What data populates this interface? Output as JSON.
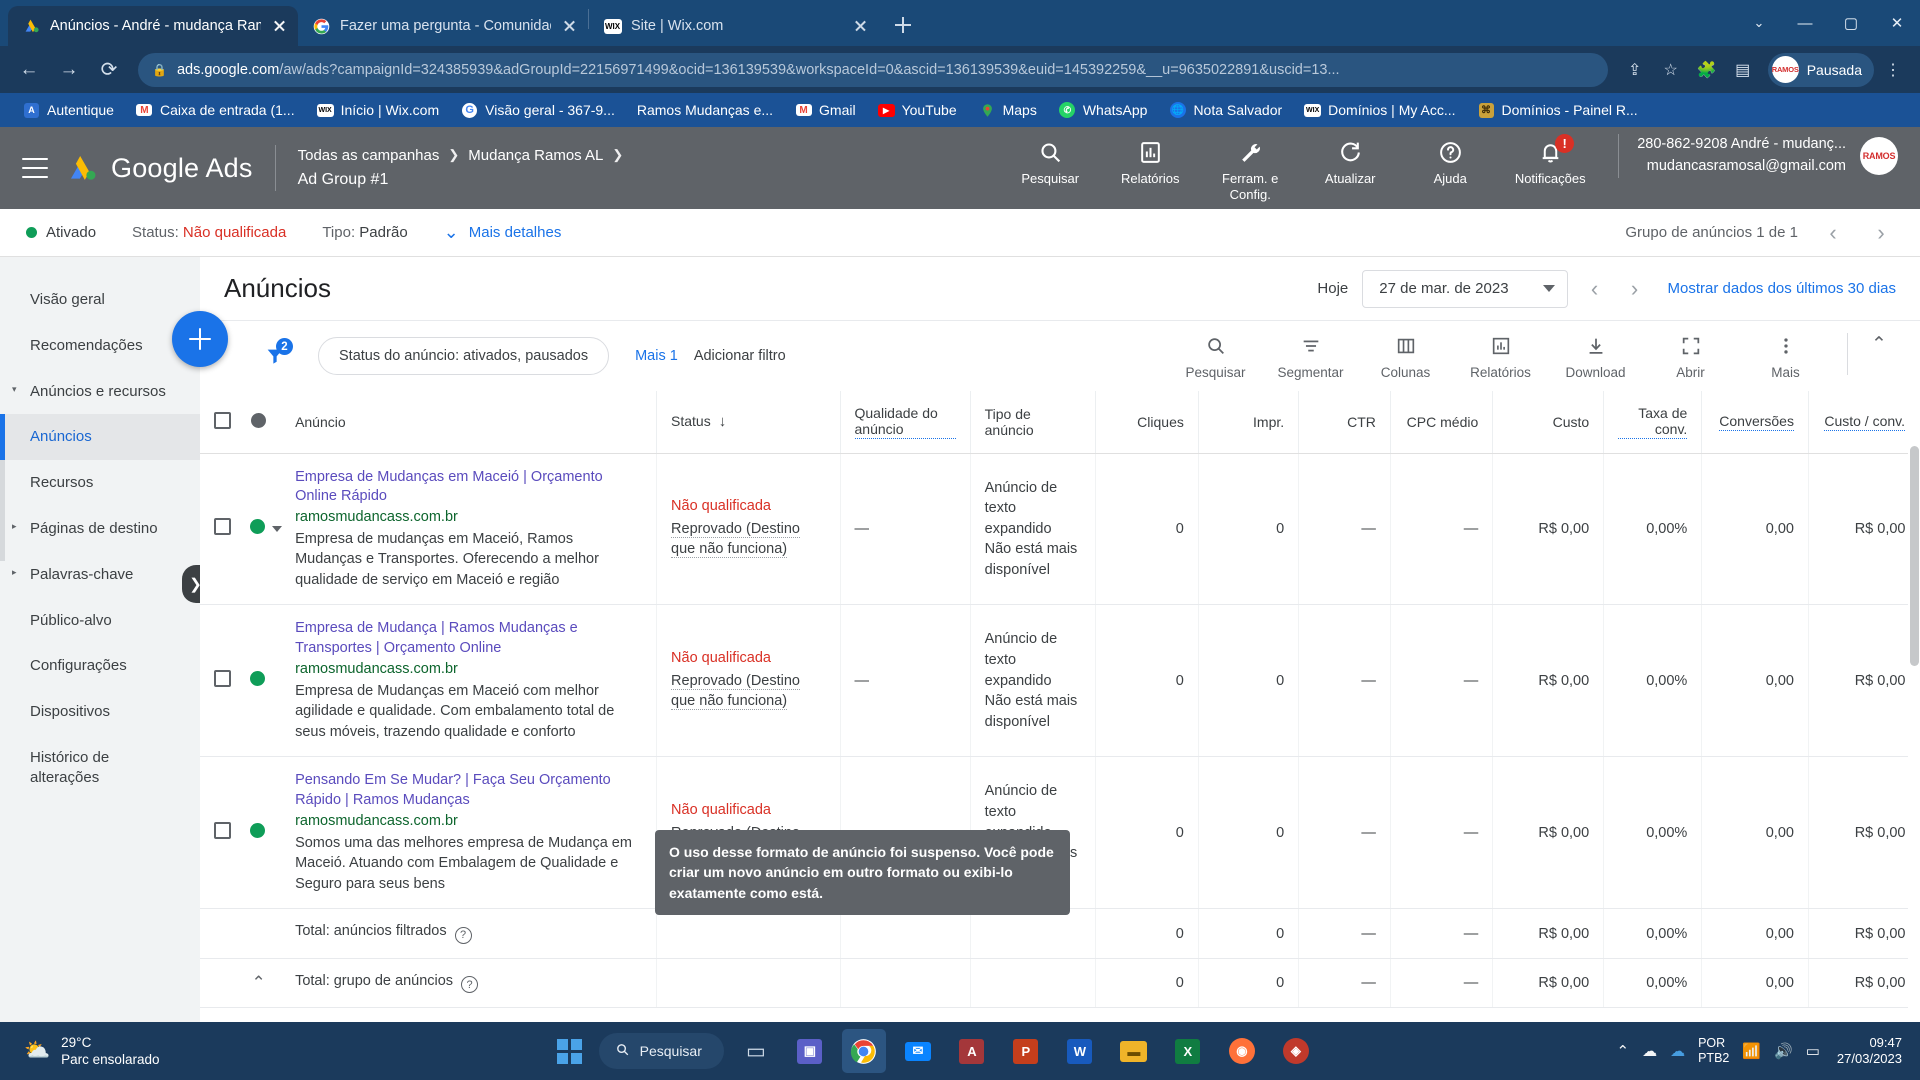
{
  "browser": {
    "tabs": [
      {
        "title": "Anúncios - André - mudança Ram",
        "favicon": "google-ads-icon",
        "active": true
      },
      {
        "title": "Fazer uma pergunta - Comunidad",
        "favicon": "google-icon",
        "active": false
      },
      {
        "title": "Site | Wix.com",
        "favicon": "wix-icon",
        "active": false
      }
    ],
    "new_tab_label": "+",
    "window_controls": [
      "chevron-down",
      "minimize",
      "maximize",
      "close"
    ],
    "url": {
      "host": "ads.google.com",
      "path": "/aw/ads?campaignId=324385939&adGroupId=22156971499&ocid=136139539&workspaceId=0&ascid=136139539&euid=145392259&__u=9635022891&uscid=13...",
      "lock": "lock-icon"
    },
    "profile_chip": {
      "label": "Pausada",
      "avatar_text": "RAMOS"
    },
    "bookmarks": [
      {
        "label": "Autentique",
        "icon": "autentique-icon"
      },
      {
        "label": "Caixa de entrada (1...",
        "icon": "gmail-icon"
      },
      {
        "label": "Início | Wix.com",
        "icon": "wix-icon"
      },
      {
        "label": "Visão geral - 367-9...",
        "icon": "google-icon"
      },
      {
        "label": "Ramos Mudanças e...",
        "icon": "none"
      },
      {
        "label": "Gmail",
        "icon": "gmail-icon"
      },
      {
        "label": "YouTube",
        "icon": "youtube-icon"
      },
      {
        "label": "Maps",
        "icon": "maps-icon"
      },
      {
        "label": "WhatsApp",
        "icon": "whatsapp-icon"
      },
      {
        "label": "Nota Salvador",
        "icon": "globe-icon"
      },
      {
        "label": "Domínios | My Acc...",
        "icon": "wix-icon"
      },
      {
        "label": "Domínios - Painel R...",
        "icon": "domains-icon"
      }
    ]
  },
  "ads_header": {
    "logo_text": "Google Ads",
    "breadcrumb": {
      "level1": "Todas as campanhas",
      "level2": "Mudança Ramos AL",
      "level3": "Ad Group #1"
    },
    "actions": [
      {
        "label": "Pesquisar",
        "icon": "search-icon"
      },
      {
        "label": "Relatórios",
        "icon": "report-icon"
      },
      {
        "label": "Ferram. e Config.",
        "icon": "wrench-icon"
      },
      {
        "label": "Atualizar",
        "icon": "refresh-icon"
      },
      {
        "label": "Ajuda",
        "icon": "help-icon"
      },
      {
        "label": "Notificações",
        "icon": "bell-icon",
        "badge": "!"
      }
    ],
    "account": {
      "id_name": "280-862-9208 André - mudanç...",
      "email": "mudancasramosal@gmail.com",
      "avatar_text": "RAMOS"
    }
  },
  "status_bar": {
    "state": "Ativado",
    "status_label": "Status:",
    "status_value": "Não qualificada",
    "type_label": "Tipo:",
    "type_value": "Padrão",
    "more_details": "Mais detalhes",
    "pager": "Grupo de anúncios 1 de 1"
  },
  "sidebar": {
    "items": [
      {
        "label": "Visão geral",
        "state": "normal"
      },
      {
        "label": "Recomendações",
        "state": "normal"
      },
      {
        "label": "Anúncios e recursos",
        "state": "expandable-open"
      },
      {
        "label": "Anúncios",
        "state": "active-sub"
      },
      {
        "label": "Recursos",
        "state": "sub"
      },
      {
        "label": "Páginas de destino",
        "state": "expandable"
      },
      {
        "label": "Palavras-chave",
        "state": "expandable"
      },
      {
        "label": "Público-alvo",
        "state": "normal"
      },
      {
        "label": "Configurações",
        "state": "normal"
      },
      {
        "label": "Dispositivos",
        "state": "normal"
      },
      {
        "label": "Histórico de alterações",
        "state": "normal"
      }
    ],
    "toggle_icon": "chevron-right-icon"
  },
  "main": {
    "page_title": "Anúncios",
    "date": {
      "today_label": "Hoje",
      "value": "27 de mar. de 2023",
      "show_last_30": "Mostrar dados dos últimos 30 dias"
    },
    "toolbar": {
      "add_button": "add-button",
      "filter_count": "2",
      "filter_chip": "Status do anúncio: ativados, pausados",
      "more_filters": "Mais 1",
      "add_filter": "Adicionar filtro",
      "actions": [
        {
          "label": "Pesquisar",
          "icon": "search-icon"
        },
        {
          "label": "Segmentar",
          "icon": "segment-icon"
        },
        {
          "label": "Colunas",
          "icon": "columns-icon"
        },
        {
          "label": "Relatórios",
          "icon": "chart-icon"
        },
        {
          "label": "Download",
          "icon": "download-icon"
        },
        {
          "label": "Abrir",
          "icon": "expand-icon"
        },
        {
          "label": "Mais",
          "icon": "more-vert-icon"
        }
      ],
      "collapse": "chevron-up-icon"
    }
  },
  "table": {
    "columns": [
      "Anúncio",
      "Status",
      "Qualidade do anúncio",
      "Tipo de anúncio",
      "Cliques",
      "Impr.",
      "CTR",
      "CPC médio",
      "Custo",
      "Taxa de conv.",
      "Conversões",
      "Custo / conv."
    ],
    "sorted_column": "Status",
    "sort_direction": "down-arrow",
    "rows": [
      {
        "dot": "green",
        "has_caret": true,
        "ad_title": "Empresa de Mudanças em Maceió | Orçamento Online Rápido",
        "ad_url": "ramosmudancass.com.br",
        "ad_desc": "Empresa de mudanças em Maceió, Ramos Mudanças e Transportes. Oferecendo a melhor qualidade de serviço em Maceió e região",
        "status_primary": "Não qualificada",
        "status_secondary": "Reprovado (Destino que não funciona)",
        "quality": "—",
        "ad_type": "Anúncio de texto expandido Não está mais disponível",
        "cliques": "0",
        "impr": "0",
        "ctr": "—",
        "cpc": "—",
        "custo": "R$ 0,00",
        "taxa_conv": "0,00%",
        "conversoes": "0,00",
        "custo_conv": "R$ 0,00"
      },
      {
        "dot": "green",
        "has_caret": false,
        "ad_title": "Empresa de Mudança | Ramos Mudanças e Transportes | Orçamento Online",
        "ad_url": "ramosmudancass.com.br",
        "ad_desc": "Empresa de Mudanças em Maceió com melhor agilidade e qualidade. Com embalamento total de seus móveis, trazendo qualidade e conforto",
        "status_primary": "Não qualificada",
        "status_secondary": "Reprovado (Destino que não funciona)",
        "quality": "—",
        "ad_type": "Anúncio de texto expandido Não está mais disponível",
        "cliques": "0",
        "impr": "0",
        "ctr": "—",
        "cpc": "—",
        "custo": "R$ 0,00",
        "taxa_conv": "0,00%",
        "conversoes": "0,00",
        "custo_conv": "R$ 0,00"
      },
      {
        "dot": "green",
        "has_caret": false,
        "ad_title": "Pensando Em Se Mudar? | Faça Seu Orçamento Rápido | Ramos Mudanças",
        "ad_url": "ramosmudancass.com.br",
        "ad_desc": "Somos uma das melhores empresa de Mudança em Maceió. Atuando com Embalagem de Qualidade e Seguro para seus bens",
        "status_primary": "Não qualificada",
        "status_secondary": "Reprovado (Destino que não funciona)",
        "quality": "—",
        "ad_type": "Anúncio de texto expandido Não está mais disponível",
        "cliques": "0",
        "impr": "0",
        "ctr": "—",
        "cpc": "—",
        "custo": "R$ 0,00",
        "taxa_conv": "0,00%",
        "conversoes": "0,00",
        "custo_conv": "R$ 0,00"
      }
    ],
    "totals": [
      {
        "label": "Total: anúncios filtrados",
        "has_help": true,
        "has_collapse": false,
        "cliques": "0",
        "impr": "0",
        "ctr": "—",
        "cpc": "—",
        "custo": "R$ 0,00",
        "taxa_conv": "0,00%",
        "conversoes": "0,00",
        "custo_conv": "R$ 0,00"
      },
      {
        "label": "Total: grupo de anúncios",
        "has_help": true,
        "has_collapse": true,
        "cliques": "0",
        "impr": "0",
        "ctr": "—",
        "cpc": "—",
        "custo": "R$ 0,00",
        "taxa_conv": "0,00%",
        "conversoes": "0,00",
        "custo_conv": "R$ 0,00"
      }
    ]
  },
  "tooltip": {
    "text": "O uso desse formato de anúncio foi suspenso. Você pode criar um novo anúncio em outro formato ou exibi-lo exatamente como está."
  },
  "taskbar": {
    "weather": {
      "temp": "29°C",
      "desc": "Parc ensolarado",
      "icon": "sun-cloud-icon"
    },
    "start_icon": "windows-icon",
    "search_label": "Pesquisar",
    "search_icon": "search-icon",
    "apps": [
      {
        "icon": "task-view-icon",
        "active": false
      },
      {
        "icon": "teams-icon",
        "active": false
      },
      {
        "icon": "chrome-icon",
        "active": true
      },
      {
        "icon": "mail-icon",
        "active": false
      },
      {
        "icon": "access-icon",
        "active": false
      },
      {
        "icon": "powerpoint-icon",
        "active": false
      },
      {
        "icon": "word-icon",
        "active": false
      },
      {
        "icon": "folder-icon",
        "active": false
      },
      {
        "icon": "excel-icon",
        "active": false
      },
      {
        "icon": "firefox-icon",
        "active": false
      },
      {
        "icon": "shield-icon",
        "active": false
      }
    ],
    "tray": {
      "chevron": "chevron-up-icon",
      "cloud": "cloud-icon",
      "onedrive": "onedrive-icon",
      "lang_line1": "POR",
      "lang_line2": "PTB2",
      "wifi": "wifi-icon",
      "volume": "volume-icon",
      "battery": "battery-icon",
      "time": "09:47",
      "date": "27/03/2023"
    }
  },
  "colors": {
    "blue_accent": "#1a73e8",
    "red_status": "#d93025",
    "green_dot": "#0f9d58",
    "header_grey": "#5f6368",
    "browser_blue": "#1b3a5c"
  }
}
